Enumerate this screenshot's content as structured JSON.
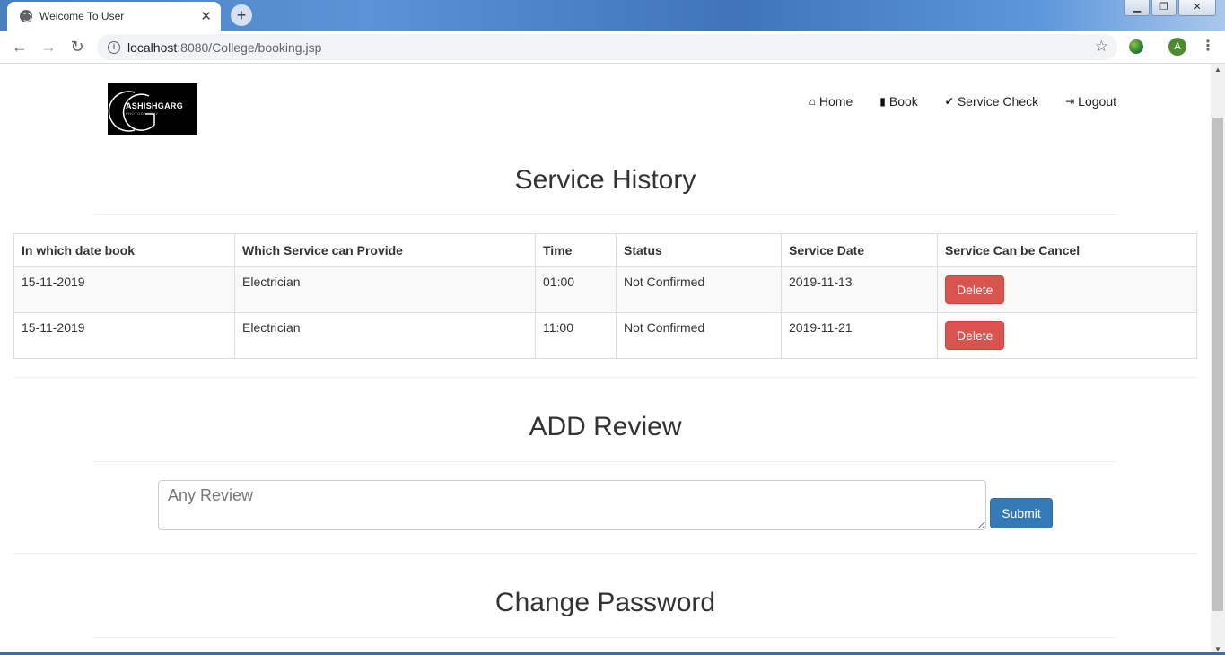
{
  "browser": {
    "tab_title": "Welcome To User",
    "url_host": "localhost",
    "url_rest": ":8080/College/booking.jsp",
    "profile_initial": "A"
  },
  "logo": {
    "text": "ASHISHGARG",
    "subtext": "PHOTOGRAPHY"
  },
  "nav": {
    "home": "Home",
    "book": "Book",
    "service_check": "Service Check",
    "logout": "Logout"
  },
  "service_history": {
    "title": "Service History",
    "headers": [
      "In which date book",
      "Which Service can Provide",
      "Time",
      "Status",
      "Service Date",
      "Service Can be Cancel"
    ],
    "rows": [
      {
        "date_booked": "15-11-2019",
        "service": "Electrician",
        "time": "01:00",
        "status": "Not Confirmed",
        "service_date": "2019-11-13",
        "action": "Delete"
      },
      {
        "date_booked": "15-11-2019",
        "service": "Electrician",
        "time": "11:00",
        "status": "Not Confirmed",
        "service_date": "2019-11-21",
        "action": "Delete"
      }
    ]
  },
  "review": {
    "title": "ADD Review",
    "placeholder": "Any Review",
    "submit_label": "Submit"
  },
  "password": {
    "title": "Change Password"
  },
  "colors": {
    "danger": "#d9534f",
    "primary": "#337ab7"
  }
}
